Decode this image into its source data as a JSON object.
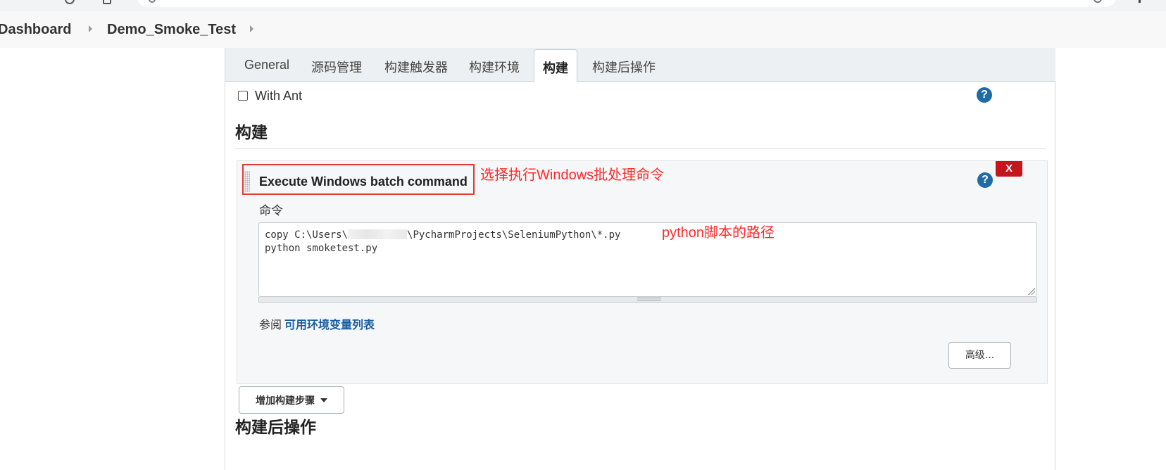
{
  "breadcrumb": {
    "items": [
      "Dashboard",
      "Demo_Smoke_Test"
    ]
  },
  "tabs": [
    "General",
    "源码管理",
    "构建触发器",
    "构建环境",
    "构建",
    "构建后操作"
  ],
  "active_tab": "构建",
  "with_ant": {
    "label": "With Ant",
    "checked": false
  },
  "build_section": {
    "title": "构建"
  },
  "build_step": {
    "title": "Execute Windows batch command",
    "delete_label": "X",
    "command_label": "命令",
    "command_lines": [
      "copy C:\\Users\\",
      "\\PycharmProjects\\SeleniumPython\\*.py",
      "python smoketest.py"
    ],
    "see_also": "参阅",
    "env_link": "可用环境变量列表",
    "advanced_label": "高级..."
  },
  "add_step_label": "增加构建步骤",
  "post_build_section": {
    "title": "构建后操作"
  },
  "annotations": {
    "select_cmd": "选择执行Windows批处理命令",
    "script_path": "python脚本的路径"
  },
  "help_glyph": "?",
  "colors": {
    "annotation": "#ff2a2a",
    "help": "#1e6ba6",
    "delete": "#c4161c",
    "link": "#1a5fa2"
  },
  "icons": [
    "help-icon",
    "chevron-right-icon",
    "drag-handle-icon",
    "caret-down-icon",
    "resize-icon"
  ]
}
